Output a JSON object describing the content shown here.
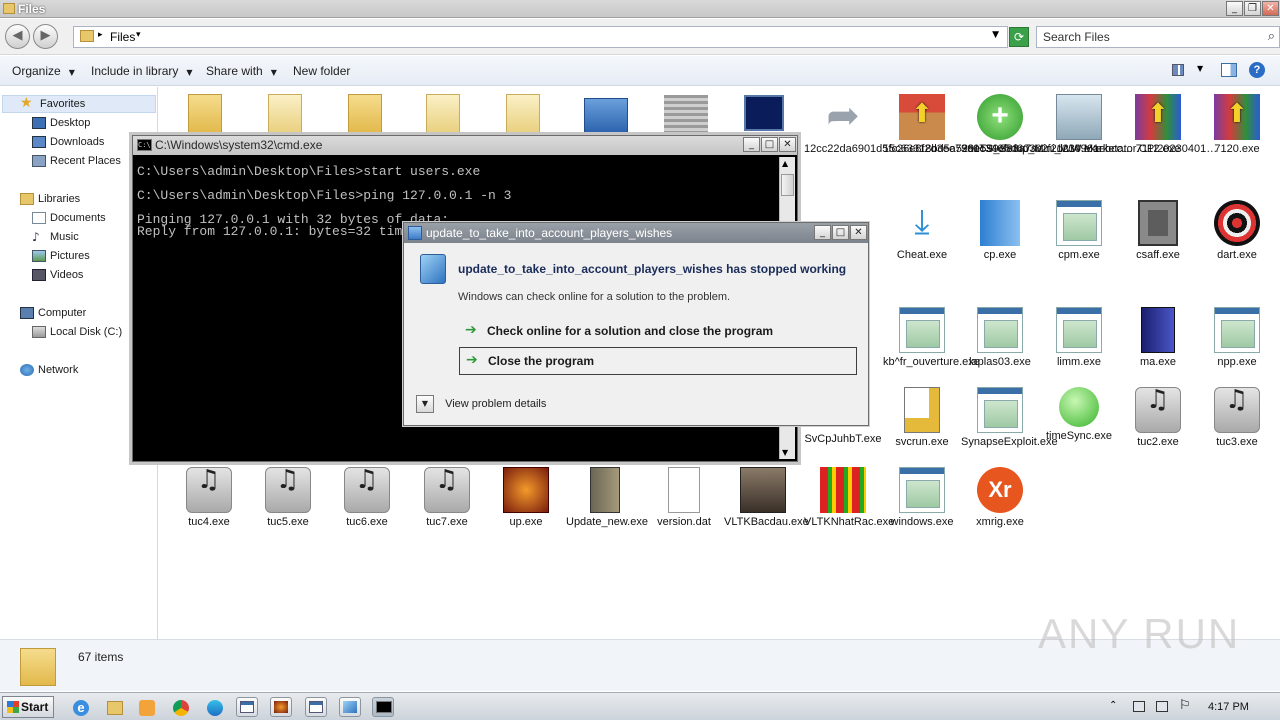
{
  "window": {
    "title": "Files"
  },
  "address": {
    "crumb": "Files",
    "search_placeholder": "Search Files"
  },
  "toolbar": {
    "organize": "Organize",
    "include": "Include in library",
    "share": "Share with",
    "new_folder": "New folder"
  },
  "nav": {
    "favorites": "Favorites",
    "desktop": "Desktop",
    "downloads": "Downloads",
    "recent": "Recent Places",
    "libraries": "Libraries",
    "documents": "Documents",
    "music": "Music",
    "pictures": "Pictures",
    "videos": "Videos",
    "computer": "Computer",
    "local_disk": "Local Disk (C:)",
    "network": "Network"
  },
  "files": {
    "r1c9": "12cc22da6901d5fc26e8f2d3ee79a1c346f83a7ae…",
    "r1c10": "15c63318bd5a529e599e5d60302f2dc14961ebcc…",
    "r1c11": "360TS_Setup_Mini_WW.Marketator.CPI20230401…",
    "r1c12": "1230.exe",
    "r1c13": "7112.exe",
    "r1c14": "7120.exe",
    "r2c10": "Cheat.exe",
    "r2c11": "cp.exe",
    "r2c12": "cpm.exe",
    "r2c13": "csaff.exe",
    "r2c14": "dart.exe",
    "r3c10": "kb^fr_ouverture.exe",
    "r3c11": "laplas03.exe",
    "r3c12": "limm.exe",
    "r3c13": "ma.exe",
    "r3c14": "npp.exe",
    "r4c9": "SvCpJuhbT.exe",
    "r4c10": "svcrun.exe",
    "r4c11": "SynapseExploit.exe",
    "r4c12": "timeSync.exe",
    "r4c13": "tuc2.exe",
    "r4c14": "tuc3.exe",
    "r5": [
      "tuc4.exe",
      "tuc5.exe",
      "tuc6.exe",
      "tuc7.exe",
      "up.exe",
      "Update_new.exe",
      "version.dat",
      "VLTKBacdau.exe",
      "VLTKNhatRac.exe",
      "windows.exe",
      "xmrig.exe"
    ]
  },
  "status": {
    "count": "67 items"
  },
  "cmd": {
    "title": "C:\\Windows\\system32\\cmd.exe",
    "lines": [
      "C:\\Users\\admin\\Desktop\\Files>start users.exe",
      "",
      "C:\\Users\\admin\\Desktop\\Files>ping 127.0.0.1 -n 3",
      "",
      "Pinging 127.0.0.1 with 32 bytes of data:",
      "Reply from 127.0.0.1: bytes=32 time<1ms TTL=128"
    ]
  },
  "dialog": {
    "title": "update_to_take_into_account_players_wishes",
    "heading": "update_to_take_into_account_players_wishes has stopped working",
    "sub": "Windows can check online for a solution to the problem.",
    "opt1": "Check online for a solution and close the program",
    "opt2": "Close the program",
    "details": "View problem details"
  },
  "taskbar": {
    "start": "Start",
    "clock": "4:17 PM"
  },
  "watermark": "ANY RUN"
}
